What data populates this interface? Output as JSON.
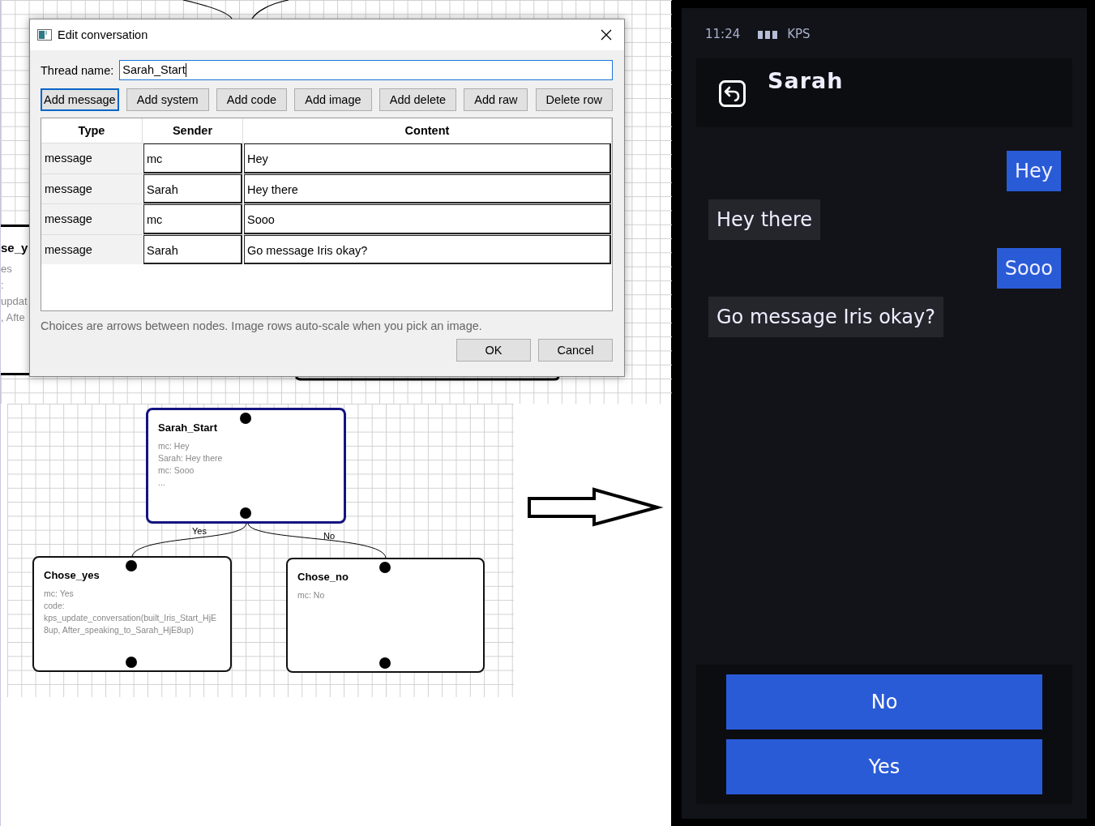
{
  "canvas": {
    "background_node": {
      "title": "se_y",
      "lines": [
        "es",
        ":",
        "updat",
        ", Afte"
      ]
    },
    "nodes": [
      {
        "title": "Sarah_Start",
        "selected": true,
        "lines": [
          "mc: Hey",
          "Sarah: Hey there",
          "mc: Sooo",
          "..."
        ]
      },
      {
        "title": "Chose_yes",
        "selected": false,
        "lines": [
          "mc: Yes",
          "code:",
          "kps_update_conversation(built_Iris_Start_HjE8up, After_speaking_to_Sarah_HjE8up)"
        ]
      },
      {
        "title": "Chose_no",
        "selected": false,
        "lines": [
          "mc: No"
        ]
      }
    ],
    "edges": [
      {
        "label": "Yes"
      },
      {
        "label": "No"
      }
    ]
  },
  "dialog": {
    "title": "Edit conversation",
    "thread_label": "Thread name:",
    "thread_value": "Sarah_Start",
    "buttons": [
      {
        "label": "Add message",
        "selected": true
      },
      {
        "label": "Add system",
        "selected": false
      },
      {
        "label": "Add code",
        "selected": false
      },
      {
        "label": "Add image",
        "selected": false
      },
      {
        "label": "Add delete",
        "selected": false
      },
      {
        "label": "Add raw",
        "selected": false
      },
      {
        "label": "Delete row",
        "selected": false
      }
    ],
    "table": {
      "columns": [
        "Type",
        "Sender",
        "Content"
      ],
      "rows": [
        {
          "type": "message",
          "sender": "mc",
          "content": "Hey"
        },
        {
          "type": "message",
          "sender": "Sarah",
          "content": "Hey there"
        },
        {
          "type": "message",
          "sender": "mc",
          "content": "Sooo"
        },
        {
          "type": "message",
          "sender": "Sarah",
          "content": "Go message Iris okay?"
        }
      ]
    },
    "note": "Choices are arrows between nodes. Image rows auto-scale when you pick an image.",
    "footer_buttons": [
      "OK",
      "Cancel"
    ]
  },
  "phone": {
    "time": "11:24",
    "carrier": "KPS",
    "contact": "Sarah",
    "messages": [
      {
        "text": "Hey",
        "kind": "sent"
      },
      {
        "text": "Hey there",
        "kind": "received"
      },
      {
        "text": "Sooo",
        "kind": "sent"
      },
      {
        "text": "Go message Iris okay?",
        "kind": "received"
      }
    ],
    "choices": [
      "No",
      "Yes"
    ]
  }
}
